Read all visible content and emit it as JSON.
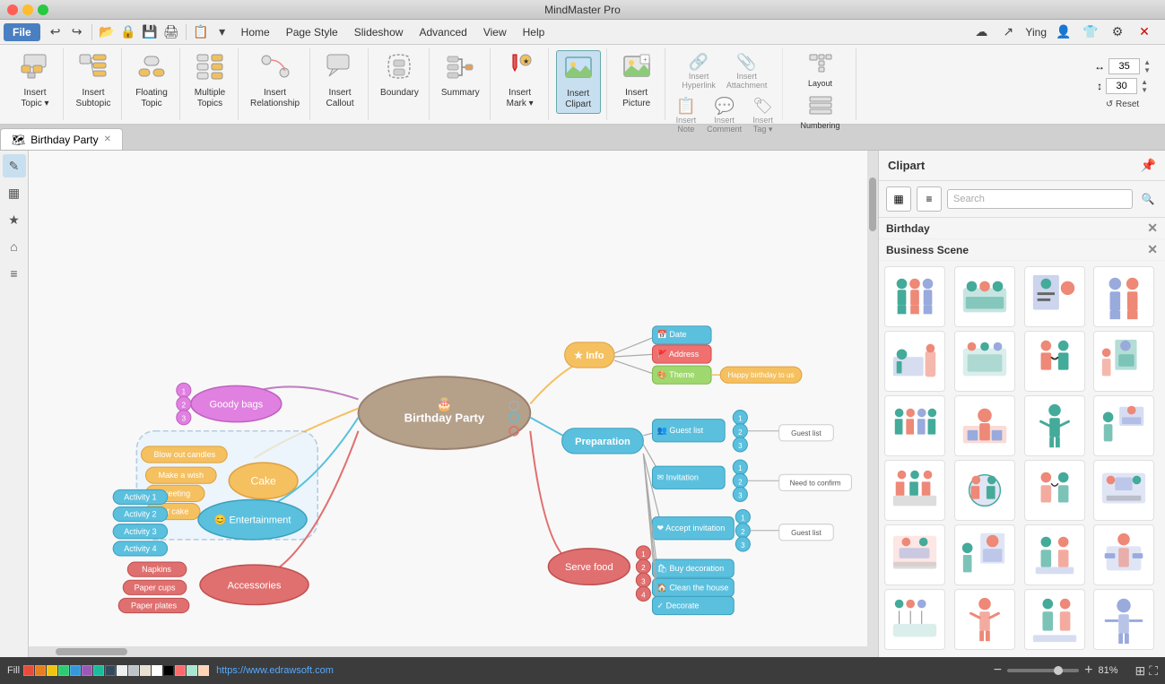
{
  "app": {
    "title": "MindMaster Pro"
  },
  "menubar": {
    "file_label": "File",
    "items": [
      "Home",
      "Page Style",
      "Slideshow",
      "Advanced",
      "View",
      "Help"
    ],
    "user": "Ying",
    "toolbar_icons": [
      "undo",
      "redo",
      "open",
      "lock",
      "save",
      "print",
      "clipboard",
      "dropdown"
    ]
  },
  "ribbon": {
    "groups": [
      {
        "id": "insert-topic",
        "label": "Insert Topic",
        "icon": "⬜"
      },
      {
        "id": "insert-subtopic",
        "label": "Insert Subtopic",
        "icon": "⬜"
      },
      {
        "id": "floating-topic",
        "label": "Floating Topic",
        "icon": "⬜"
      },
      {
        "id": "multiple-topics",
        "label": "Multiple Topics",
        "icon": "⬜"
      },
      {
        "id": "insert-relationship",
        "label": "Insert Relationship",
        "icon": "〜"
      },
      {
        "id": "insert-callout",
        "label": "Insert Callout",
        "icon": "💬"
      },
      {
        "id": "boundary",
        "label": "Boundary",
        "icon": "⬡"
      },
      {
        "id": "summary",
        "label": "Summary",
        "icon": "}"
      },
      {
        "id": "insert-mark",
        "label": "Insert Mark",
        "icon": "⚑"
      },
      {
        "id": "insert-clipart",
        "label": "Insert Clipart",
        "icon": "🖼",
        "active": true
      },
      {
        "id": "insert-picture",
        "label": "Insert Picture",
        "icon": "🏔"
      },
      {
        "id": "insert-hyperlink",
        "label": "Insert Hyperlink",
        "icon": "🔗",
        "disabled": true
      },
      {
        "id": "insert-attachment",
        "label": "Insert Attachment",
        "icon": "📎",
        "disabled": true
      },
      {
        "id": "insert-note",
        "label": "Insert Note",
        "icon": "📋",
        "disabled": true
      },
      {
        "id": "insert-comment",
        "label": "Insert Comment",
        "icon": "💬",
        "disabled": true
      },
      {
        "id": "insert-tag",
        "label": "Insert Tag",
        "icon": "🏷",
        "disabled": true
      }
    ],
    "layout_label": "Layout",
    "numbering_label": "Numbering",
    "reset_label": "↺ Reset",
    "width_value": "35",
    "height_value": "30"
  },
  "tab": {
    "label": "Birthday Party",
    "icon": "🗺"
  },
  "clipart": {
    "title": "Clipart",
    "categories": [
      {
        "name": "Birthday",
        "close": true
      },
      {
        "name": "Business Scene",
        "close": true
      }
    ],
    "search_placeholder": "Search",
    "items": [
      {
        "id": 1,
        "type": "people-group"
      },
      {
        "id": 2,
        "type": "meeting-table"
      },
      {
        "id": 3,
        "type": "presentation"
      },
      {
        "id": 4,
        "type": "people-standing"
      },
      {
        "id": 5,
        "type": "desk-work"
      },
      {
        "id": 6,
        "type": "desk-meeting"
      },
      {
        "id": 7,
        "type": "people-chat"
      },
      {
        "id": 8,
        "type": "office-work"
      },
      {
        "id": 9,
        "type": "people-group2"
      },
      {
        "id": 10,
        "type": "briefing"
      },
      {
        "id": 11,
        "type": "people-stand"
      },
      {
        "id": 12,
        "type": "desk-side"
      },
      {
        "id": 13,
        "type": "team-work"
      },
      {
        "id": 14,
        "type": "global-meeting"
      },
      {
        "id": 15,
        "type": "people-talking"
      },
      {
        "id": 16,
        "type": "office-scene"
      },
      {
        "id": 17,
        "type": "board-meeting"
      },
      {
        "id": 18,
        "type": "presenter"
      },
      {
        "id": 19,
        "type": "pair-work"
      },
      {
        "id": 20,
        "type": "laptop-work"
      },
      {
        "id": 21,
        "type": "group-discussion"
      },
      {
        "id": 22,
        "type": "staff"
      },
      {
        "id": 23,
        "type": "manager"
      },
      {
        "id": 24,
        "type": "alone-worker"
      }
    ]
  },
  "statusbar": {
    "fill_label": "Fill",
    "link": "https://www.edrawsoft.com",
    "zoom_percent": "81%"
  }
}
